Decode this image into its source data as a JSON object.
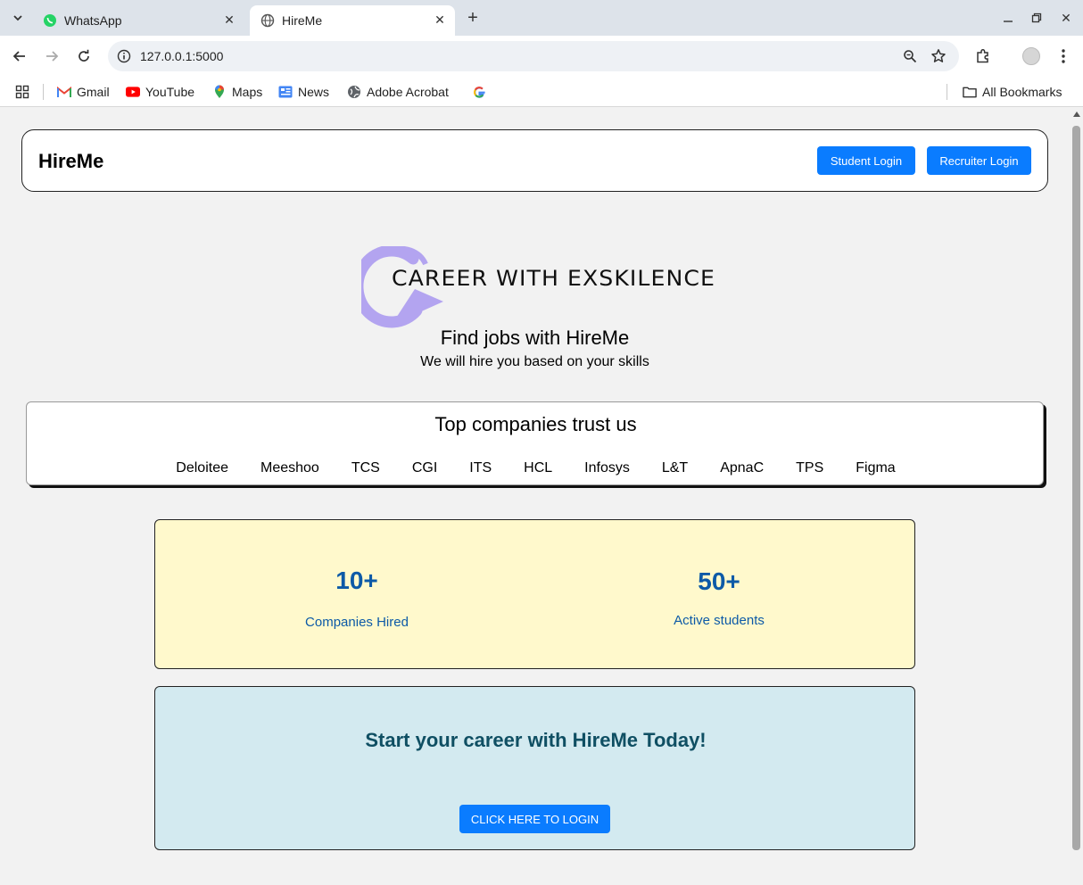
{
  "browser": {
    "tabs": [
      {
        "title": "WhatsApp",
        "icon": "whatsapp-icon",
        "active": false
      },
      {
        "title": "HireMe",
        "icon": "globe-icon",
        "active": true
      }
    ],
    "url": "127.0.0.1:5000",
    "bookmarks": [
      {
        "label": "Gmail",
        "icon": "gmail-icon"
      },
      {
        "label": "YouTube",
        "icon": "youtube-icon"
      },
      {
        "label": "Maps",
        "icon": "maps-icon"
      },
      {
        "label": "News",
        "icon": "news-icon"
      },
      {
        "label": "Adobe Acrobat",
        "icon": "globe-icon"
      }
    ],
    "all_bookmarks_label": "All Bookmarks"
  },
  "navbar": {
    "brand": "HireMe",
    "student_login": "Student Login",
    "recruiter_login": "Recruiter Login"
  },
  "hero": {
    "logo_text": "CAREER WITH EXSKILENCE",
    "title": "Find jobs with HireMe",
    "subtitle": "We will hire you based on your skills"
  },
  "companies": {
    "title": "Top companies trust us",
    "list": [
      "Deloitee",
      "Meeshoo",
      "TCS",
      "CGI",
      "ITS",
      "HCL",
      "Infosys",
      "L&T",
      "ApnaC",
      "TPS",
      "Figma"
    ]
  },
  "stats": [
    {
      "value": "10+",
      "label": "Companies Hired"
    },
    {
      "value": "50+",
      "label": "Active students"
    }
  ],
  "cta": {
    "title": "Start your career with HireMe Today!",
    "button": "CLICK HERE TO LOGIN"
  },
  "colors": {
    "primary_button": "#0a7cff",
    "stats_bg": "#fff9cc",
    "stats_text": "#0d5aa7",
    "cta_bg": "#d3eaf0",
    "cta_title": "#0f4f63",
    "logo_accent": "#b3a4f0"
  }
}
